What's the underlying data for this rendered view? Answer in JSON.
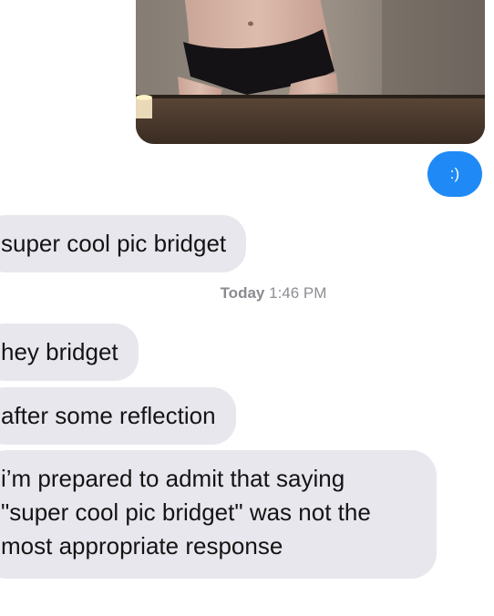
{
  "conversation": {
    "outgoing": {
      "photo": {
        "description_icon": "photo-attachment"
      },
      "reply_text": ":)",
      "bubble_color": "#1f8af5"
    },
    "incoming_bubble_color": "#e8e7ee",
    "first_message": "super cool pic bridget",
    "timestamp": {
      "day": "Today",
      "time": "1:46 PM"
    },
    "messages": [
      "hey bridget",
      "after some reflection",
      "i’m prepared to admit that saying \"super cool pic bridget\" was not the most appropriate response"
    ]
  }
}
